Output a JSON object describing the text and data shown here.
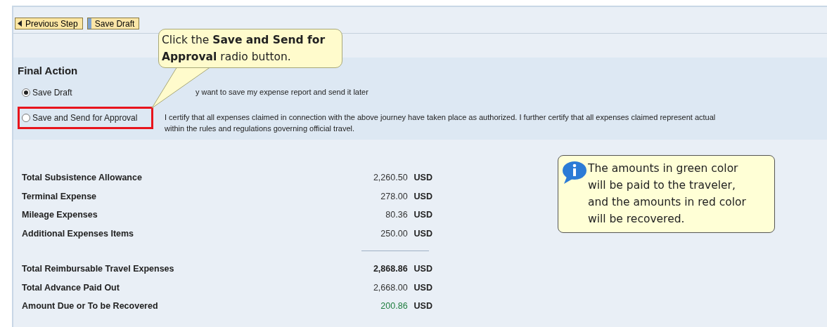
{
  "toolbar": {
    "buttons": [
      {
        "label": "Previous Step",
        "kind": "back"
      },
      {
        "label": "Save Draft",
        "kind": "plain"
      }
    ]
  },
  "final_action": {
    "title": "Final Action",
    "options": [
      {
        "label": "Save Draft",
        "selected": true,
        "highlighted": false,
        "description": [
          "y want to save my expense report and send it later"
        ]
      },
      {
        "label": "Save and Send for Approval",
        "selected": false,
        "highlighted": true,
        "description": [
          "I certify that all expenses claimed in connection with the above journey have taken place as authorized. I further certify that all expenses claimed represent actual",
          "within the rules and regulations governing official travel."
        ]
      }
    ]
  },
  "summary": {
    "groups": [
      [
        {
          "label": "Total Subsistence Allowance",
          "amount": "2,260.50",
          "currency": "USD",
          "bold": false,
          "color": "#333333"
        },
        {
          "label": "Terminal Expense",
          "amount": "278.00",
          "currency": "USD",
          "bold": false,
          "color": "#333333"
        },
        {
          "label": "Mileage Expenses",
          "amount": "80.36",
          "currency": "USD",
          "bold": false,
          "color": "#333333"
        },
        {
          "label": "Additional Expenses Items",
          "amount": "250.00",
          "currency": "USD",
          "bold": false,
          "color": "#333333"
        }
      ],
      [
        {
          "label": "Total Reimbursable Travel Expenses",
          "amount": "2,868.86",
          "currency": "USD",
          "bold": true,
          "color": "#222222"
        },
        {
          "label": "Total Advance Paid Out",
          "amount": "2,668.00",
          "currency": "USD",
          "bold": false,
          "color": "#333333"
        },
        {
          "label": "Amount Due or To be Recovered",
          "amount": "200.86",
          "currency": "USD",
          "bold": false,
          "color": "#1e7d3e"
        }
      ]
    ]
  },
  "callouts": [
    {
      "text": "Click the **Save and Send for Approval** radio button."
    },
    {
      "text": "The amounts in green color will be paid to the traveler, and the amounts in red color will be recovered."
    }
  ]
}
